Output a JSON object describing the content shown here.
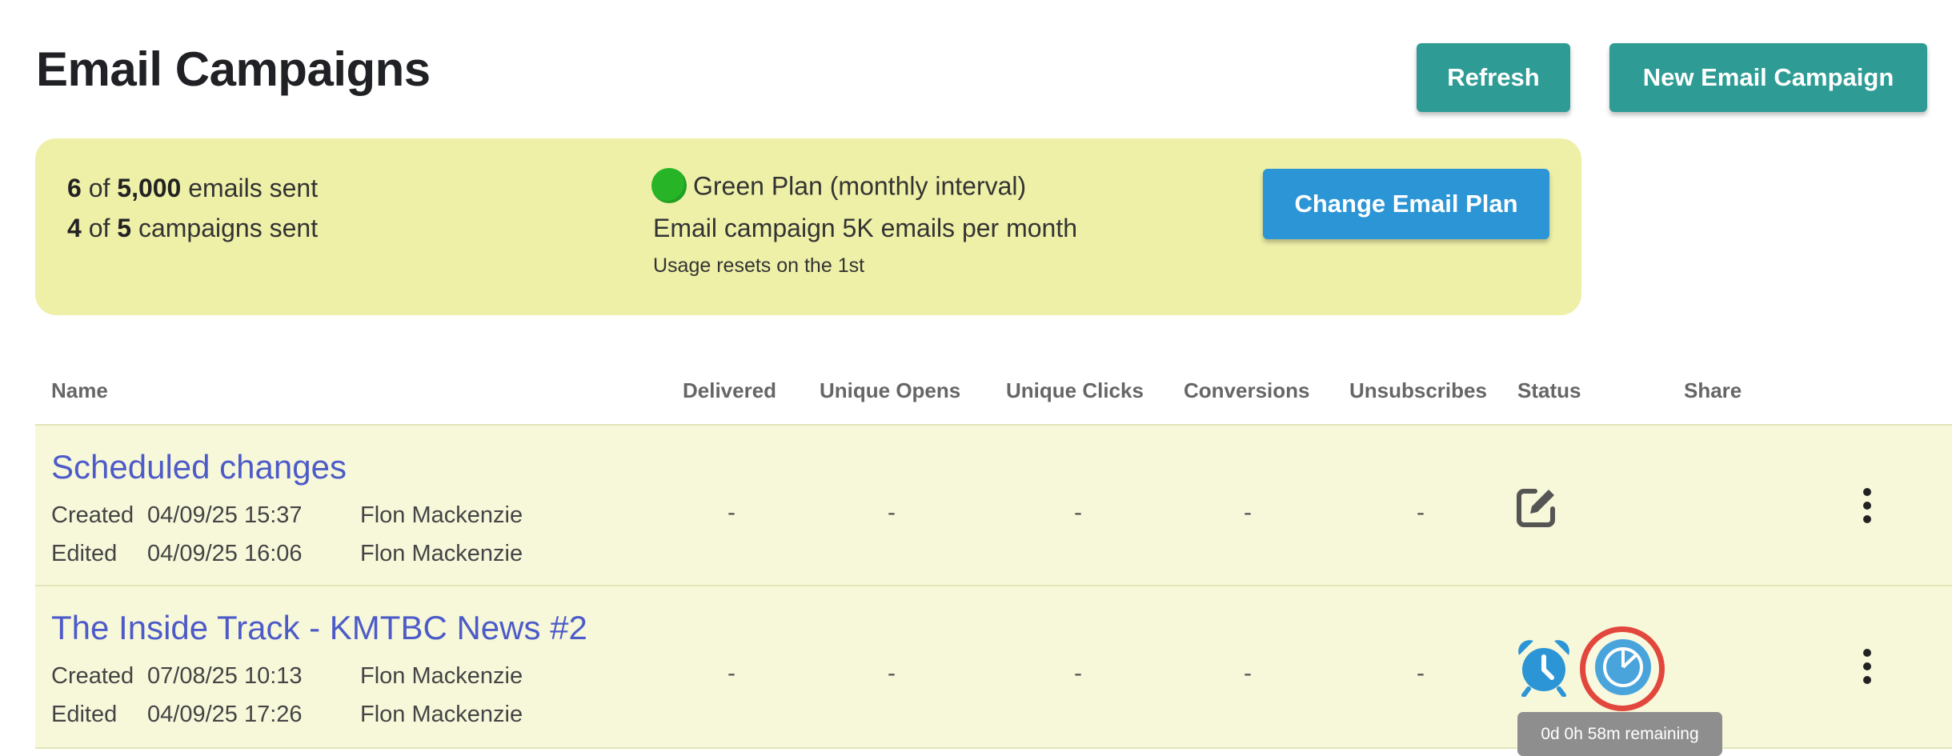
{
  "header": {
    "title": "Email Campaigns",
    "refresh_label": "Refresh",
    "new_campaign_label": "New Email Campaign"
  },
  "usage": {
    "emails_sent": "6",
    "emails_of": "of",
    "emails_total": "5,000",
    "emails_suffix": "emails sent",
    "campaigns_sent": "4",
    "campaigns_of": "of",
    "campaigns_total": "5",
    "campaigns_suffix": "campaigns sent",
    "plan_name": "Green Plan (monthly interval)",
    "plan_description": "Email campaign 5K emails per month",
    "reset_note": "Usage resets on the 1st",
    "change_plan_label": "Change Email Plan",
    "plan_color": "#27b427"
  },
  "table": {
    "columns": [
      "Name",
      "Delivered",
      "Unique Opens",
      "Unique Clicks",
      "Conversions",
      "Unsubscribes",
      "Status",
      "Share"
    ],
    "rows": [
      {
        "name": "Scheduled changes",
        "created_label": "Created",
        "created_date": "04/09/25 15:37",
        "created_by": "Flon Mackenzie",
        "edited_label": "Edited",
        "edited_date": "04/09/25 16:06",
        "edited_by": "Flon Mackenzie",
        "delivered": "-",
        "unique_opens": "-",
        "unique_clicks": "-",
        "conversions": "-",
        "unsubscribes": "-",
        "status_icon": "edit-icon"
      },
      {
        "name": "The Inside Track - KMTBC News #2",
        "created_label": "Created",
        "created_date": "07/08/25 10:13",
        "created_by": "Flon Mackenzie",
        "edited_label": "Edited",
        "edited_date": "04/09/25 17:26",
        "edited_by": "Flon Mackenzie",
        "delivered": "-",
        "unique_opens": "-",
        "unique_clicks": "-",
        "conversions": "-",
        "unsubscribes": "-",
        "status_icon": "alarm-clock-icon"
      }
    ]
  },
  "tooltip": {
    "text": "0d 0h 58m remaining"
  },
  "colors": {
    "accent_teal": "#2e9c95",
    "accent_blue": "#2b95d6",
    "link": "#4d5bc9",
    "highlight": "#e2473d"
  }
}
